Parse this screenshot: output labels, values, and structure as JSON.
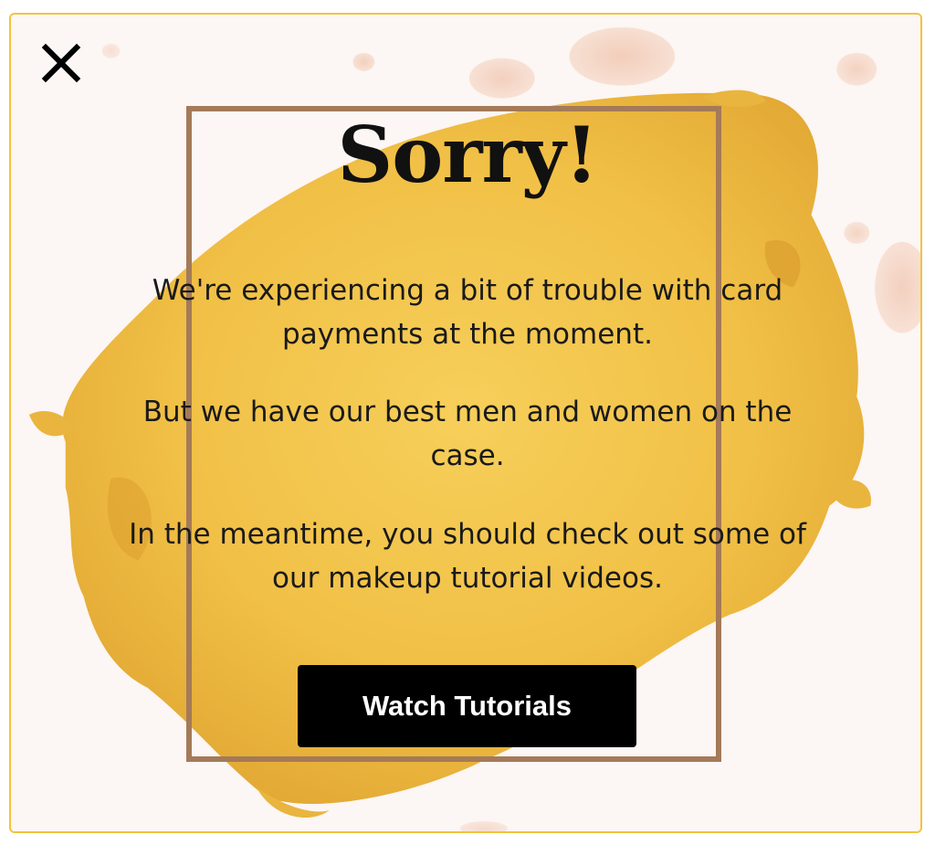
{
  "popup": {
    "title": "Sorry!",
    "messages": [
      "We're experiencing a bit of trouble with card payments at the moment.",
      "But we have our best men and women on the case.",
      "In the meantime, you should check out some of our makeup tutorial videos."
    ],
    "cta_label": "Watch Tutorials",
    "close_icon": "close-icon"
  },
  "colors": {
    "border": "#f0c43c",
    "gold_paint": "#f2c24a",
    "frame": "#a47a58",
    "button_bg": "#000000",
    "button_text": "#ffffff",
    "text": "#111111"
  }
}
